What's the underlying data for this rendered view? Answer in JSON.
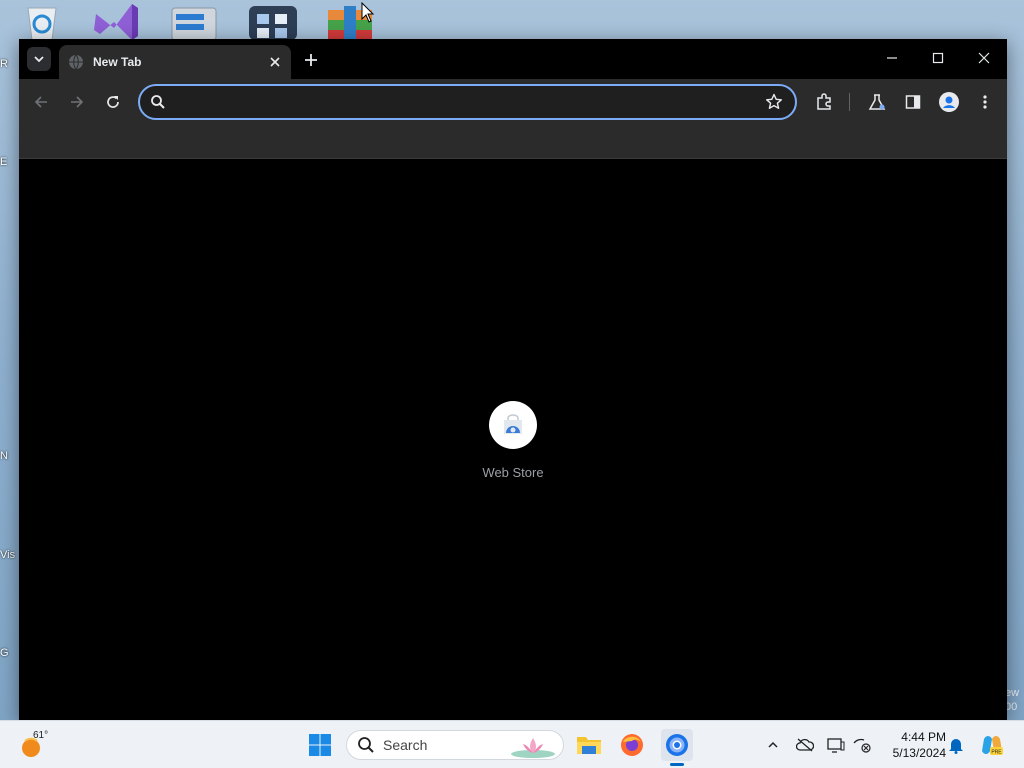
{
  "desktop": {
    "icons": [
      {
        "name": "recycle-bin-icon"
      },
      {
        "name": "visual-studio-icon"
      },
      {
        "name": "server-manager-icon"
      },
      {
        "name": "control-panel-icon"
      },
      {
        "name": "winrar-icon"
      }
    ],
    "left_fragments": [
      "R",
      "E",
      "N",
      "Vis",
      "G"
    ],
    "watermark": [
      "ew",
      "00"
    ]
  },
  "browser": {
    "tab": {
      "title": "New Tab",
      "favicon": "globe-icon"
    },
    "window_controls": [
      "minimize-icon",
      "maximize-icon",
      "close-icon"
    ],
    "omnibox": {
      "value": "",
      "placeholder": ""
    },
    "toolbar_icons": [
      "back-arrow-icon",
      "forward-arrow-icon",
      "reload-icon",
      "bookmark-star-icon",
      "extensions-icon",
      "labs-icon",
      "side-panel-icon",
      "profile-icon",
      "menu-icon"
    ],
    "shortcut": {
      "label": "Web Store",
      "icon": "web-store-icon"
    }
  },
  "taskbar": {
    "weather": {
      "temp": "61°",
      "icon": "weather-sun-icon"
    },
    "search": {
      "label": "Search"
    },
    "apps": [
      "start-icon",
      "file-explorer-icon",
      "firefox-icon",
      "chrome-icon"
    ],
    "tray": [
      "chevron-up-icon",
      "onedrive-icon",
      "display-icon",
      "network-icon",
      "notifications-icon",
      "copilot-icon"
    ],
    "clock": {
      "time": "4:44 PM",
      "date": "5/13/2024"
    }
  },
  "colors": {
    "accent": "#7cacf8",
    "window_bg": "#000000",
    "toolbar_bg": "#2b2b2b",
    "taskbar_bg": "#eef2f7"
  }
}
